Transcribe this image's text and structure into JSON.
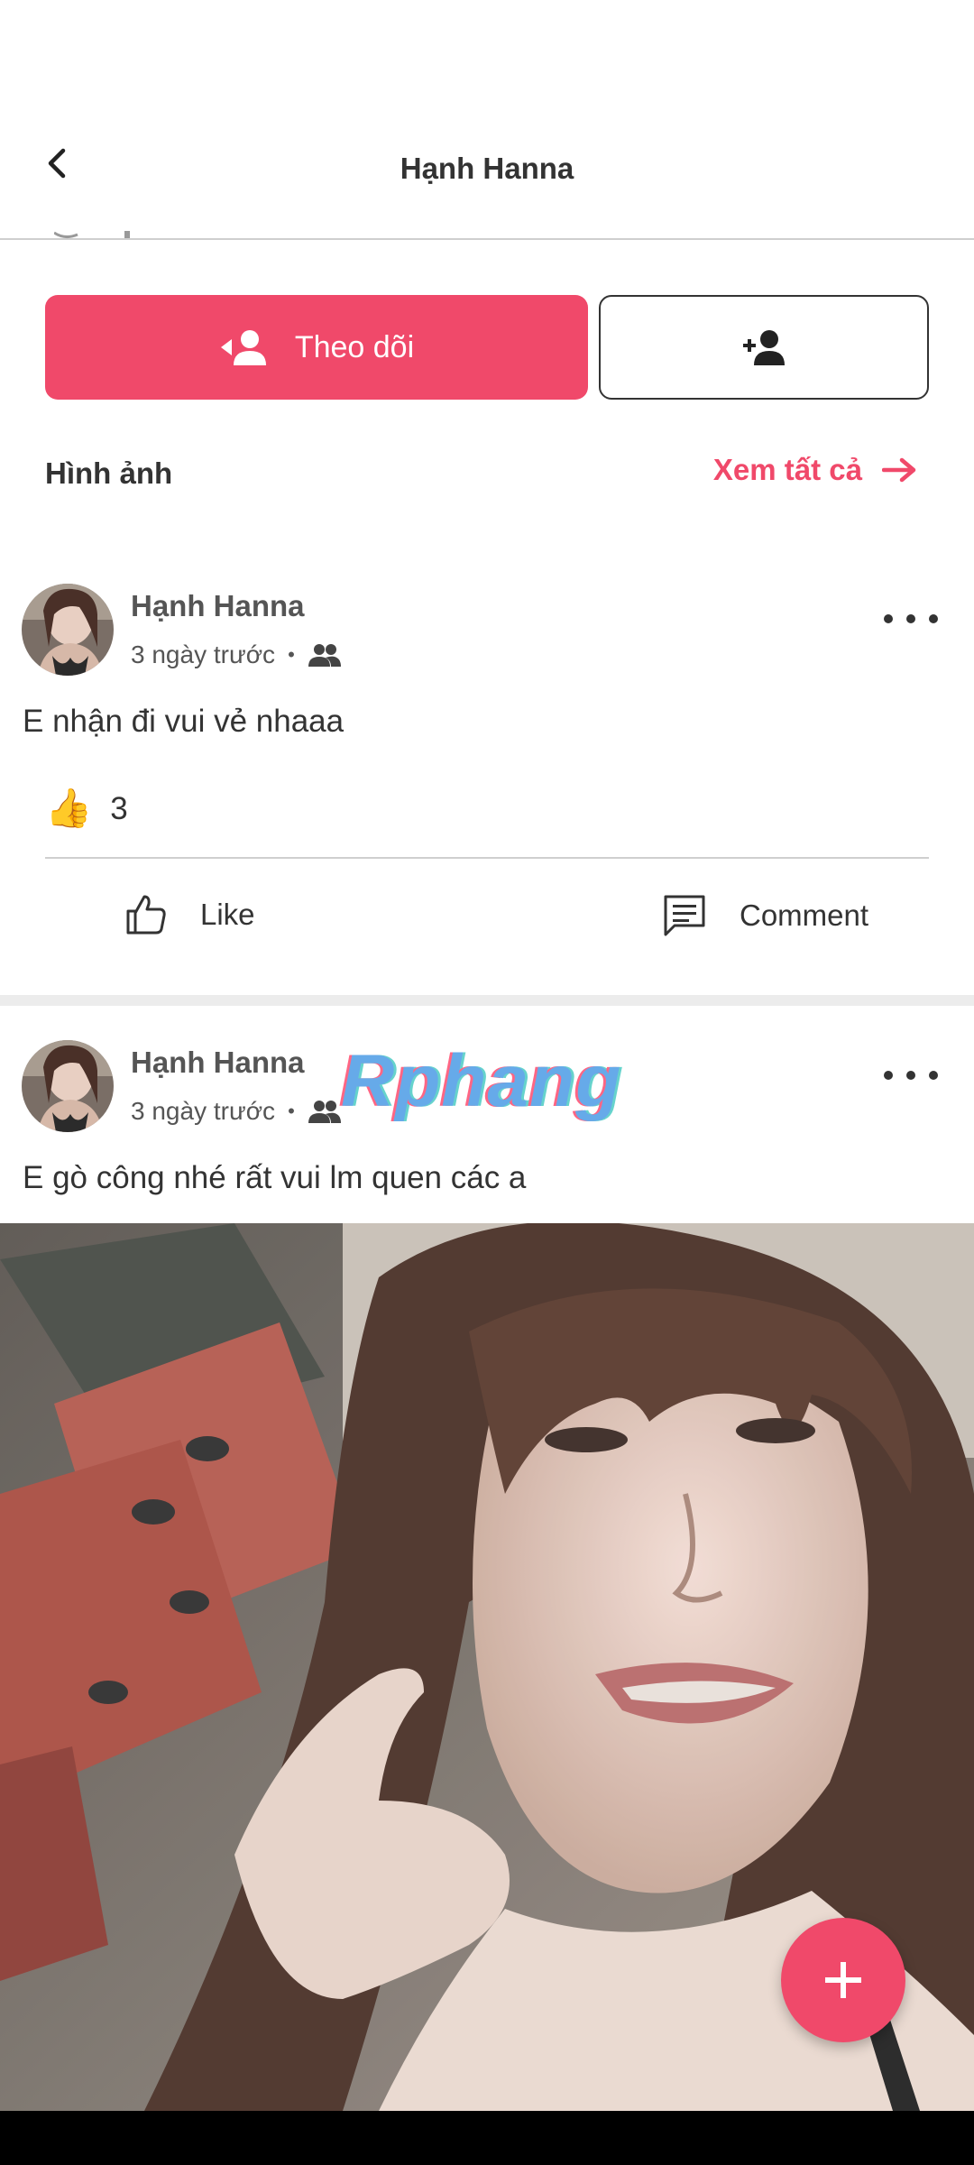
{
  "header": {
    "title": "Hạnh Hanna"
  },
  "profile_actions": {
    "follow_label": "Theo dõi"
  },
  "photos_section": {
    "title": "Hình ảnh",
    "see_all_label": "Xem tất cả"
  },
  "posts": [
    {
      "author": "Hạnh Hanna",
      "time": "3 ngày trước",
      "privacy_icon": "friends-icon",
      "text": "E nhận đi vui vẻ nhaaa",
      "reaction_icon": "thumbs-up-emoji",
      "reaction_count": "3",
      "like_label": "Like",
      "comment_label": "Comment"
    },
    {
      "author": "Hạnh Hanna",
      "time": "3 ngày trước",
      "privacy_icon": "friends-icon",
      "text": "E gò công nhé rất vui lm quen các a",
      "has_photo": true
    }
  ],
  "watermark": "Rphang",
  "colors": {
    "accent": "#f0496a",
    "text": "#333333",
    "divider": "#cfcfcf"
  }
}
